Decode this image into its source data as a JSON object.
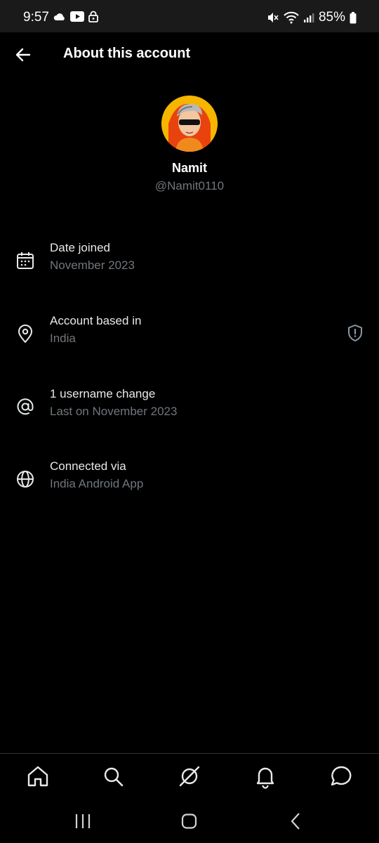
{
  "status_bar": {
    "time": "9:57",
    "battery": "85%"
  },
  "header": {
    "title": "About this account"
  },
  "profile": {
    "name": "Namit",
    "handle": "@Namit0110"
  },
  "info": [
    {
      "icon": "calendar-icon",
      "title": "Date joined",
      "subtitle": "November 2023"
    },
    {
      "icon": "location-pin-icon",
      "title": "Account based in",
      "subtitle": "India"
    },
    {
      "icon": "at-sign-icon",
      "title": "1 username change",
      "subtitle": "Last on November 2023"
    },
    {
      "icon": "globe-icon",
      "title": "Connected via",
      "subtitle": "India Android App"
    }
  ],
  "bottom_nav": [
    "home-icon",
    "search-icon",
    "grok-icon",
    "notifications-icon",
    "messages-icon"
  ],
  "colors": {
    "background": "#000000",
    "primary_text": "#e7e9ea",
    "secondary_text": "#71767b",
    "divider": "#2f3336"
  }
}
